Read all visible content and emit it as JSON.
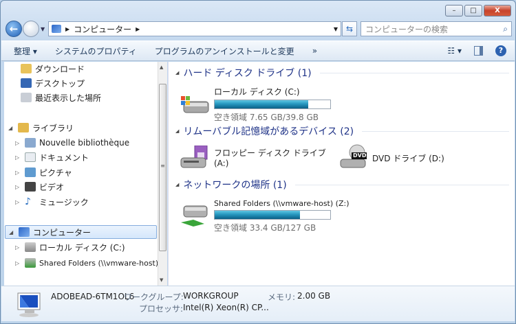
{
  "window": {
    "controls": {
      "minimize": "–",
      "maximize": "□",
      "close": "X"
    }
  },
  "address": {
    "segments": [
      "コンピューター"
    ],
    "search_placeholder": "コンピューターの検索"
  },
  "toolbar": {
    "organize": "整理 ▾",
    "system_properties": "システムのプロパティ",
    "uninstall": "プログラムのアンインストールと変更",
    "more": "»"
  },
  "nav": {
    "favorites": [
      {
        "label": "ダウンロード"
      },
      {
        "label": "デスクトップ"
      },
      {
        "label": "最近表示した場所"
      }
    ],
    "libraries": {
      "label": "ライブラリ",
      "items": [
        {
          "label": "Nouvelle bibliothèque"
        },
        {
          "label": "ドキュメント"
        },
        {
          "label": "ピクチャ"
        },
        {
          "label": "ビデオ"
        },
        {
          "label": "ミュージック"
        }
      ]
    },
    "computer": {
      "label": "コンピューター",
      "items": [
        {
          "label": "ローカル ディスク (C:)"
        },
        {
          "label": "Shared Folders (\\\\vmware-host) (Z:)"
        }
      ]
    }
  },
  "groups": [
    {
      "title": "ハード ディスク ドライブ (1)",
      "drives": [
        {
          "name": "ローカル ディスク (C:)",
          "free": "空き領域 7.65 GB/39.8 GB",
          "used_fraction": 0.81
        }
      ]
    },
    {
      "title": "リムーバブル記憶域があるデバイス (2)",
      "drives": [
        {
          "name": "フロッピー ディスク ドライブ",
          "name2": "(A:)"
        },
        {
          "name": "DVD ドライブ (D:)",
          "badge": "DVD"
        }
      ]
    },
    {
      "title": "ネットワークの場所 (1)",
      "drives": [
        {
          "name": "Shared Folders (\\\\vmware-host) (Z:)",
          "free": "空き領域 33.4 GB/127 GB",
          "used_fraction": 0.737
        }
      ]
    }
  ],
  "details": {
    "computer_name": "ADOBEAD-6TM1OL6",
    "workgroup_label": "ワークグループ:",
    "workgroup": "WORKGROUP",
    "memory_label": "メモリ:",
    "memory": "2.00 GB",
    "processor_label": "プロセッサ:",
    "processor": "Intel(R) Xeon(R) CP..."
  }
}
